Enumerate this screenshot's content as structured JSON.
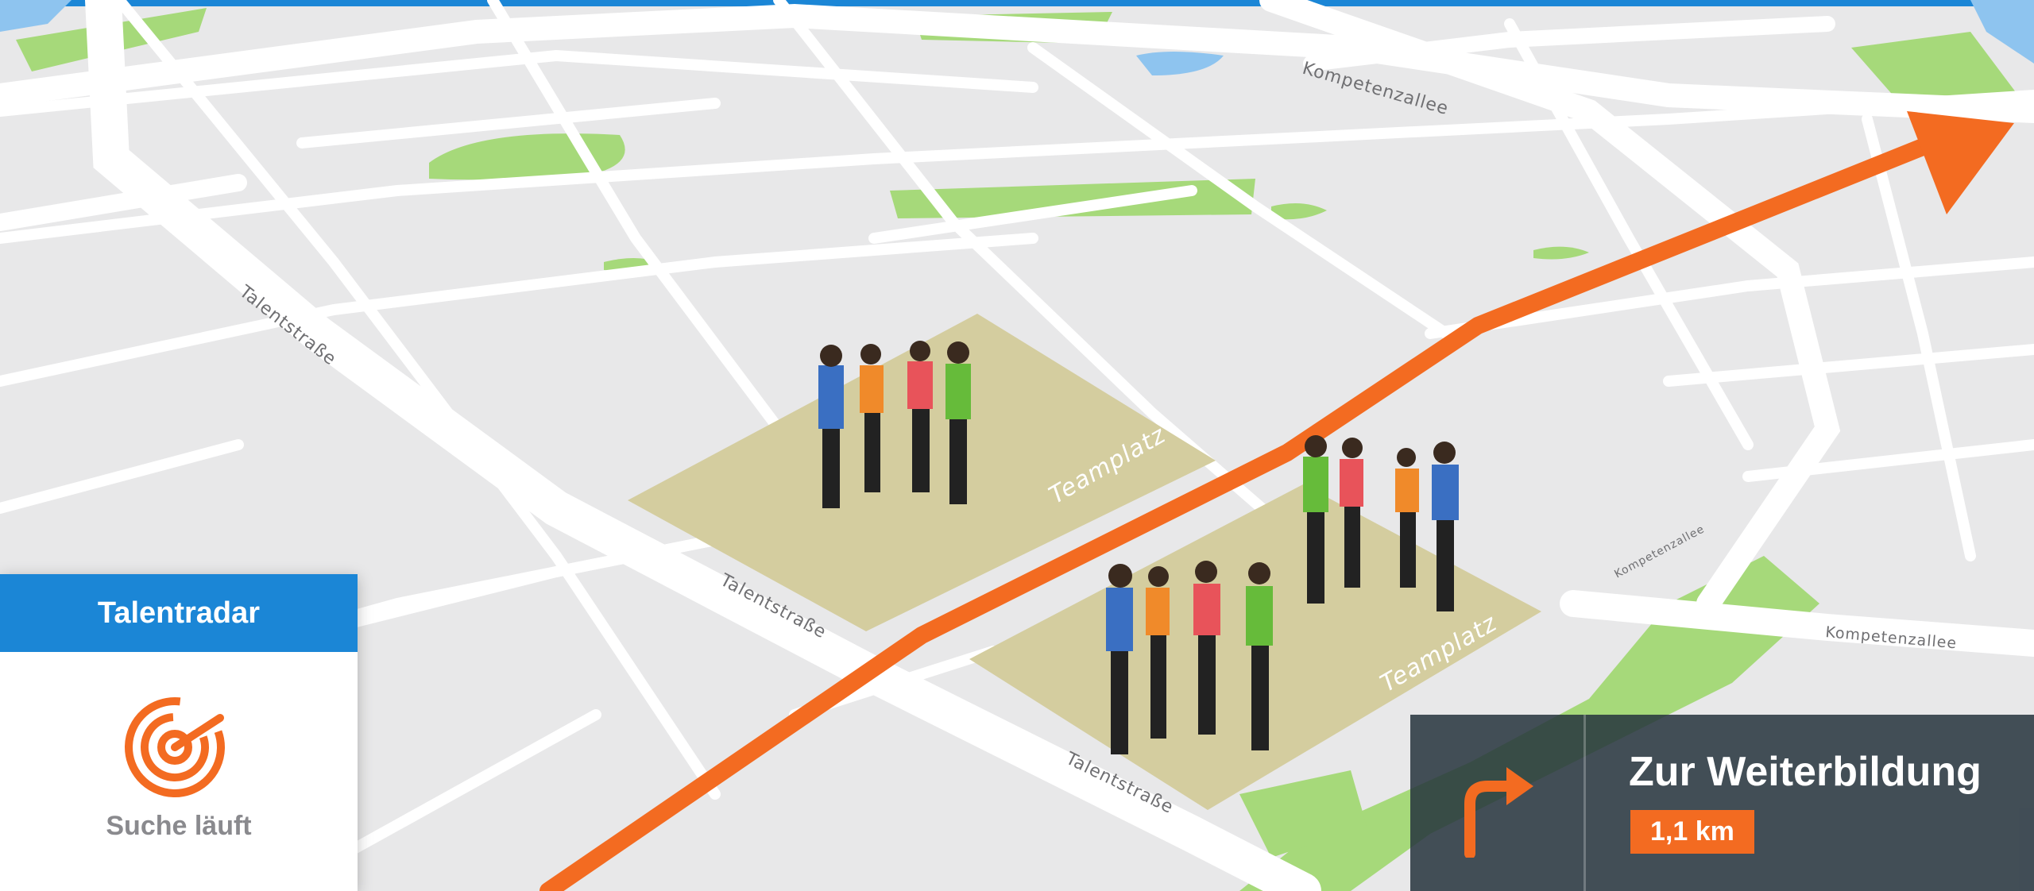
{
  "map": {
    "streets": {
      "talent_1": "Talentstraße",
      "talent_2": "Talentstraße",
      "talent_3": "Talentstraße",
      "kompetenz_1": "Kompetenzallee",
      "kompetenz_2": "Kompetenzallee",
      "kompetenz_3": "Kompetenzallee"
    },
    "plazas": {
      "plaza_1": "Teamplatz",
      "plaza_2": "Teamplatz"
    },
    "route_color": "#f36b21",
    "park_color": "#a6d97a",
    "water_color": "#8ec4ef"
  },
  "radar": {
    "title": "Talentradar",
    "status": "Suche läuft",
    "icon": "radar-icon",
    "header_color": "#1b86d6"
  },
  "navigation": {
    "icon": "turn-right-arrow-icon",
    "destination": "Zur Weiterbildung",
    "distance": "1,1 km",
    "accent_color": "#f36b21"
  }
}
